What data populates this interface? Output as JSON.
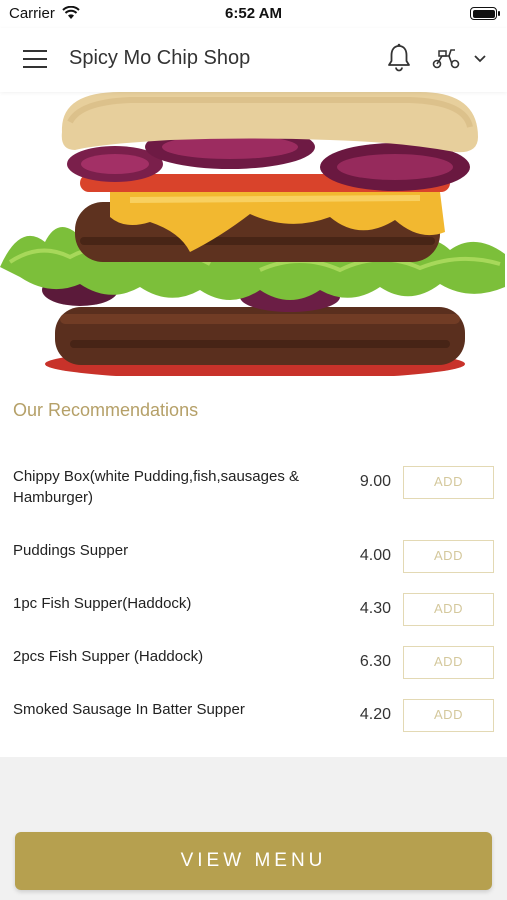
{
  "status": {
    "carrier": "Carrier",
    "time": "6:52 AM"
  },
  "header": {
    "title": "Spicy Mo Chip Shop"
  },
  "recommendations": {
    "title": "Our Recommendations",
    "items": [
      {
        "name": "Chippy Box(white Pudding,fish,sausages & Hamburger)",
        "price": "9.00",
        "add_label": "ADD"
      },
      {
        "name": "Puddings Supper",
        "price": "4.00",
        "add_label": "ADD"
      },
      {
        "name": "1pc Fish Supper(Haddock)",
        "price": "4.30",
        "add_label": "ADD"
      },
      {
        "name": "2pcs Fish Supper (Haddock)",
        "price": "6.30",
        "add_label": "ADD"
      },
      {
        "name": "Smoked Sausage In Batter Supper",
        "price": "4.20",
        "add_label": "ADD"
      }
    ]
  },
  "footer": {
    "view_menu_label": "VIEW MENU"
  },
  "colors": {
    "accent": "#b6a04f",
    "section_title": "#b5a068",
    "add_border": "#e3d9b4"
  },
  "icons": [
    "wifi-icon",
    "battery-icon",
    "hamburger-menu-icon",
    "bell-icon",
    "scooter-icon",
    "chevron-down-icon"
  ]
}
